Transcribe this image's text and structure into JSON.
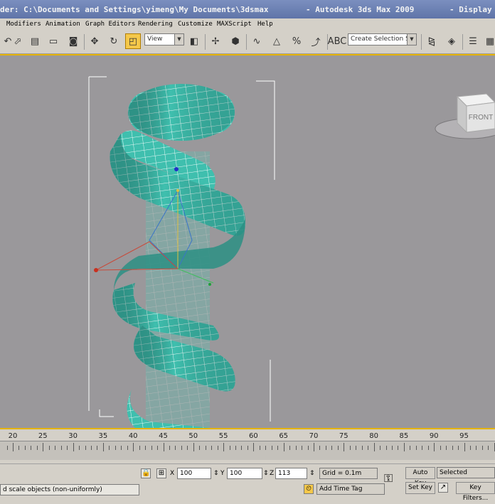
{
  "title": {
    "left": "der: C:\\Documents and Settings\\yimeng\\My Documents\\3dsmax",
    "middle": "- Autodesk 3ds Max  2009",
    "right": "- Display"
  },
  "menu": [
    "Modifiers",
    "Animation",
    "Graph Editors",
    "Rendering",
    "Customize",
    "MAXScript",
    "Help"
  ],
  "toolbar": {
    "view_select": "View",
    "selection_set_placeholder": "Create Selection Set",
    "icons": [
      "select-arrow-icon",
      "select-by-name-icon",
      "rect-region-icon",
      "window-crossing-icon",
      "move-icon",
      "rotate-icon",
      "scale-icon",
      "reference-coord-icon",
      "mirror-icon",
      "snap-icon",
      "angle-snap-icon",
      "percent-snap-icon",
      "spinner-snap-icon",
      "named-sets-icon",
      "align-icon",
      "layer-icon",
      "curve-editor-icon"
    ]
  },
  "viewcube": {
    "label": "FRONT"
  },
  "timeline": {
    "ticks": [
      20,
      25,
      30,
      35,
      40,
      45,
      50,
      55,
      60,
      65,
      70,
      75,
      80,
      85,
      90,
      95
    ]
  },
  "status": {
    "x_value": "100",
    "y_value": "100",
    "z_value": "113",
    "grid": "Grid = 0.1m",
    "prompt": "d scale objects (non-uniformly)",
    "add_time_tag": "Add Time Tag",
    "auto_key": "Auto Key",
    "set_key": "Set Key",
    "selected": "Selected",
    "key_filters": "Key Filters..."
  },
  "colors": {
    "accent": "#e6b400",
    "viewport_bg": "#9a989b",
    "mesh": "#3fbfae",
    "wire": "#ffffff"
  }
}
